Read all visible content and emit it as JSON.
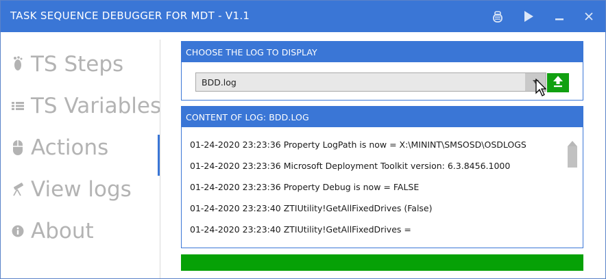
{
  "window": {
    "title": "TASK SEQUENCE DEBUGGER FOR MDT - V1.1",
    "buttons": [
      "bug-icon",
      "play-icon",
      "minimize-icon",
      "close-icon"
    ]
  },
  "sidebar": {
    "items": [
      {
        "label": "TS Steps",
        "icon": "footprint-icon"
      },
      {
        "label": "TS Variables",
        "icon": "list-icon"
      },
      {
        "label": "Actions",
        "icon": "mouse-icon"
      },
      {
        "label": "View logs",
        "icon": "telescope-icon"
      },
      {
        "label": "About",
        "icon": "info-icon"
      }
    ],
    "active": "View logs"
  },
  "choose_log": {
    "header": "CHOOSE THE LOG TO DISPLAY",
    "selected": "BDD.log"
  },
  "content": {
    "header": "CONTENT OF LOG: BDD.LOG",
    "lines": [
      "01-24-2020 23:23:36 Property LogPath is now = X:\\MININT\\SMSOSD\\OSDLOGS",
      "01-24-2020 23:23:36 Microsoft Deployment Toolkit version: 6.3.8456.1000",
      "01-24-2020 23:23:36 Property Debug is now = FALSE",
      "01-24-2020 23:23:40 ZTIUtility!GetAllFixedDrives (False)",
      "01-24-2020 23:23:40 ZTIUtility!GetAllFixedDrives ="
    ]
  },
  "progress": 1.0,
  "colors": {
    "accent": "#3a76d6",
    "progress": "#06a106",
    "nav_text": "#b3b3b3"
  }
}
